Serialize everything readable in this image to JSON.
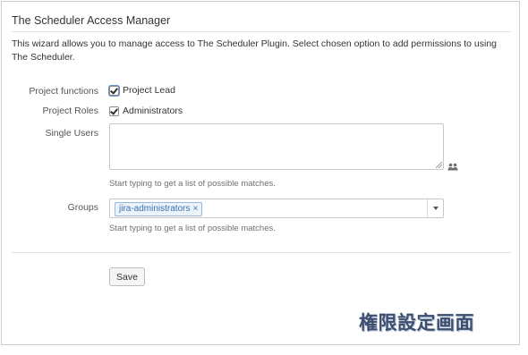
{
  "panel": {
    "title": "The Scheduler Access Manager",
    "description": "This wizard allows you to manage access to The Scheduler Plugin. Select chosen option to add permissions to using The Scheduler."
  },
  "form": {
    "project_functions": {
      "label": "Project functions",
      "option": "Project Lead",
      "checked": true
    },
    "project_roles": {
      "label": "Project Roles",
      "option": "Administrators",
      "checked": true
    },
    "single_users": {
      "label": "Single Users",
      "value": "",
      "hint": "Start typing to get a list of possible matches.",
      "icon": "users-picker-icon"
    },
    "groups": {
      "label": "Groups",
      "selected": [
        "jira-administrators"
      ],
      "remove_symbol": "×",
      "hint": "Start typing to get a list of possible matches."
    },
    "save_label": "Save"
  },
  "caption": "権限設定画面"
}
